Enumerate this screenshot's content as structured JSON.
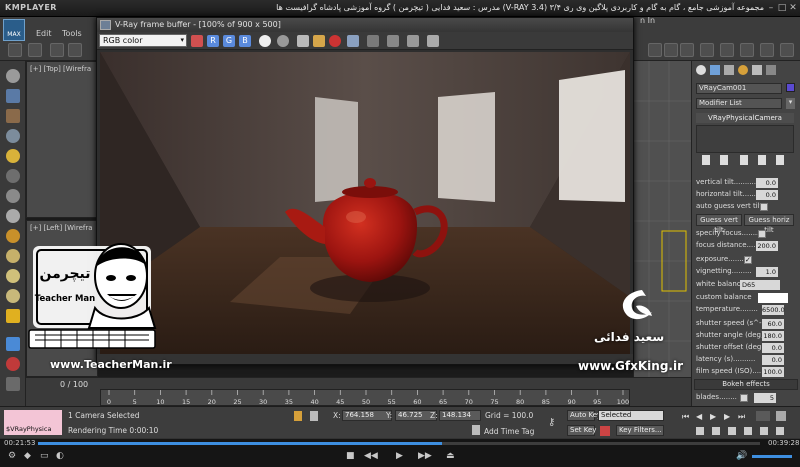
{
  "player": {
    "app_name": "KMPLAYER",
    "title": "مجموعه آموزشی جامع ، گام به گام و کاربردی پلاگین وی ری ۳/۴ (V-RAY 3.4)  مدرس : سعید فدایی ( تیچرمن ) گروه آموزشی پادشاه گرافیست ها",
    "time_elapsed": "00:21:53",
    "time_total": "00:39:28",
    "progress_fraction": 0.56
  },
  "max": {
    "logo_text": "MAX",
    "menus": [
      "Edit",
      "Tools"
    ],
    "search_hint": "n In"
  },
  "viewports": {
    "top_label": "[+] [Top] [Wirefra",
    "left_label": "[+] [Left] [Wirefra"
  },
  "frame_buffer": {
    "title": "V-Ray frame buffer - [100% of 900 x 500]",
    "channel": "RGB color",
    "channel_buttons": [
      "R",
      "G",
      "B"
    ]
  },
  "command_panel": {
    "object_name": "VRayCam001",
    "modifier_list": "Modifier List",
    "stack_item": "VRayPhysicalCamera",
    "params": [
      {
        "label": "vertical tilt..........",
        "value": "0.0"
      },
      {
        "label": "horizontal tilt........",
        "value": "0.0"
      },
      {
        "label": "auto guess vert tilt",
        "checkbox": true
      }
    ],
    "guess_vert": "Guess vert tilt",
    "guess_horiz": "Guess horiz tilt",
    "params2": [
      {
        "label": "specify focus..........",
        "checkbox": true
      },
      {
        "label": "focus distance.....",
        "value": "200.0"
      },
      {
        "label": "exposure...........",
        "checkbox": true
      },
      {
        "label": "vignetting.........",
        "value": "1.0"
      },
      {
        "label": "white balance",
        "value": "D65"
      },
      {
        "label": "custom balance",
        "value": ""
      },
      {
        "label": "temperature........",
        "value": "6500.0"
      },
      {
        "label": "shutter speed (s^-1)",
        "value": "60.0"
      },
      {
        "label": "shutter angle (deg)",
        "value": "180.0"
      },
      {
        "label": "shutter offset (deg)",
        "value": "0.0"
      },
      {
        "label": "latency (s)..........",
        "value": "0.0"
      },
      {
        "label": "film speed (ISO)....",
        "value": "100.0"
      }
    ],
    "bokeh_rollout": "Bokeh effects",
    "blades_label": "blades........",
    "blades_value": "5"
  },
  "timeline": {
    "frame_counter": "0 / 100",
    "ticks": [
      "0",
      "5",
      "10",
      "15",
      "20",
      "25",
      "30",
      "35",
      "40",
      "45",
      "50",
      "55",
      "60",
      "65",
      "70",
      "75",
      "80",
      "85",
      "90",
      "95",
      "100"
    ]
  },
  "status": {
    "script_label": "$VRayPhysica",
    "selected_text": "1 Camera Selected",
    "render_time": "Rendering Time  0:00:10",
    "x_label": "X:",
    "x_value": "764.158",
    "y_label": "Y:",
    "y_value": "46.725",
    "z_label": "Z:",
    "z_value": "148.134",
    "grid": "Grid = 100.0",
    "add_time_tag": "Add Time Tag",
    "auto_key": "Auto Key",
    "set_key": "Set Key",
    "selected_dropdown": "Selected",
    "key_filters": "Key Filters..."
  },
  "watermarks": {
    "tm_logo_persian": "تیچرمن",
    "tm_logo_english": "Teacher Man",
    "tm_url": "www.TeacherMan.ir",
    "gfx_name": "سعید فدائی",
    "gfx_url": "www.GfxKing.ir"
  }
}
